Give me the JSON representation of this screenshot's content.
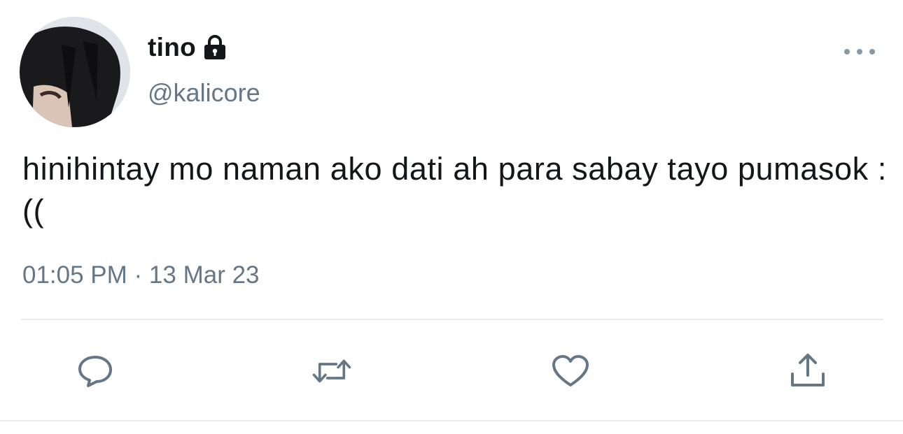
{
  "tweet": {
    "display_name": "tino",
    "handle": "@kalicore",
    "text": "hinihintay mo naman ako dati ah para sabay tayo pumasok :((",
    "time": "01:05 PM",
    "separator": " · ",
    "date": "13 Mar 23"
  },
  "icons": {
    "lock": "lock-icon",
    "more": "more-options-icon",
    "reply": "reply-icon",
    "retweet": "retweet-icon",
    "like": "like-heart-icon",
    "share": "share-icon"
  },
  "colors": {
    "text": "#14171a",
    "secondary": "#657786",
    "icon": "#657786",
    "divider": "#e6ecf0"
  }
}
